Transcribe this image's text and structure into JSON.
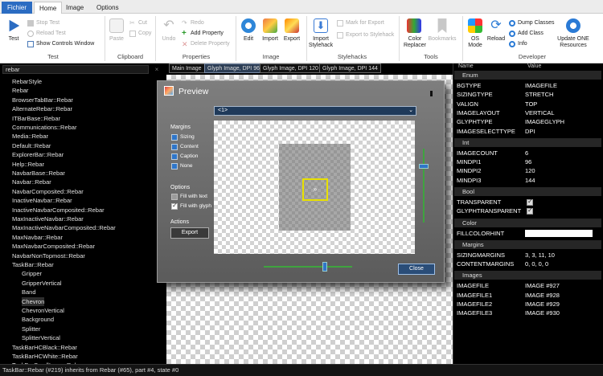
{
  "ribbon": {
    "tabs": [
      "Fichier",
      "Home",
      "Image",
      "Options"
    ],
    "test": {
      "big": "Test",
      "stop": "Stop Test",
      "reload": "Reload Test",
      "show": "Show Controls Window",
      "group": "Test"
    },
    "clipboard": {
      "paste": "Paste",
      "cut": "Cut",
      "copy": "Copy",
      "group": "Clipboard"
    },
    "properties": {
      "undo": "Undo",
      "redo": "Redo",
      "add": "Add Property",
      "delete": "Delete Property",
      "group": "Properties"
    },
    "image": {
      "edit": "Edit",
      "import": "Import",
      "export": "Export",
      "group": "Image"
    },
    "stylehacks": {
      "import": "Import Stylehack",
      "mark": "Mark for Export",
      "export": "Export to Stylehack",
      "group": "Stylehacks"
    },
    "tools": {
      "color": "Color Replacer",
      "bookmarks": "Bookmarks",
      "group": "Tools"
    },
    "developer": {
      "os": "OS Mode",
      "reload": "Reload",
      "dump": "Dump Classes",
      "addclass": "Add Class",
      "info": "Info",
      "update": "Update ONE Resources",
      "group": "Developer"
    }
  },
  "search": {
    "value": "rebar"
  },
  "tree": [
    {
      "label": "RebarStyle",
      "child": false
    },
    {
      "label": "Rebar",
      "child": false
    },
    {
      "label": "BrowserTabBar::Rebar",
      "child": false
    },
    {
      "label": "AlternateRebar::Rebar",
      "child": false
    },
    {
      "label": "ITBarBase::Rebar",
      "child": false
    },
    {
      "label": "Communications::Rebar",
      "child": false
    },
    {
      "label": "Media::Rebar",
      "child": false
    },
    {
      "label": "Default::Rebar",
      "child": false
    },
    {
      "label": "ExplorerBar::Rebar",
      "child": false
    },
    {
      "label": "Help::Rebar",
      "child": false
    },
    {
      "label": "NavbarBase::Rebar",
      "child": false
    },
    {
      "label": "Navbar::Rebar",
      "child": false
    },
    {
      "label": "NavbarComposited::Rebar",
      "child": false
    },
    {
      "label": "InactiveNavbar::Rebar",
      "child": false
    },
    {
      "label": "InactiveNavbarComposited::Rebar",
      "child": false
    },
    {
      "label": "MaxInactiveNavbar::Rebar",
      "child": false
    },
    {
      "label": "MaxInactiveNavbarComposited::Rebar",
      "child": false
    },
    {
      "label": "MaxNavbar::Rebar",
      "child": false
    },
    {
      "label": "MaxNavbarComposited::Rebar",
      "child": false
    },
    {
      "label": "NavbarNonTopmost::Rebar",
      "child": false
    },
    {
      "label": "TaskBar::Rebar",
      "child": false
    },
    {
      "label": "Gripper",
      "child": true
    },
    {
      "label": "GripperVertical",
      "child": true
    },
    {
      "label": "Band",
      "child": true
    },
    {
      "label": "Chevron",
      "child": true,
      "selected": true
    },
    {
      "label": "ChevronVertical",
      "child": true
    },
    {
      "label": "Background",
      "child": true
    },
    {
      "label": "Splitter",
      "child": true
    },
    {
      "label": "SplitterVertical",
      "child": true
    },
    {
      "label": "TaskBarHCBlack::Rebar",
      "child": false
    },
    {
      "label": "TaskBarHCWhite::Rebar",
      "child": false
    },
    {
      "label": "TaskBarSmallIcons::Rebar",
      "child": false
    }
  ],
  "doc_tabs": [
    "Main Image",
    "Glyph Image, DPI 96",
    "Glyph Image, DPI 120",
    "Glyph Image, DPI 144"
  ],
  "preview": {
    "title": "Preview",
    "select": "<1>",
    "margins_label": "Margins",
    "margins": [
      "Sizing",
      "Content",
      "Caption",
      "None"
    ],
    "options_label": "Options",
    "fill_text": "Fill with text",
    "fill_glyph": "Fill with glyph",
    "actions_label": "Actions",
    "export": "Export",
    "close": "Close",
    "chevron_glyph": "»"
  },
  "props": {
    "col_name": "Name",
    "col_value": "Value",
    "sections": {
      "enum": "Enum",
      "int": "Int",
      "bool": "Bool",
      "color": "Color",
      "margins": "Margins",
      "images": "Images"
    },
    "enum": [
      [
        "BGTYPE",
        "IMAGEFILE"
      ],
      [
        "SIZINGTYPE",
        "STRETCH"
      ],
      [
        "VALIGN",
        "TOP"
      ],
      [
        "IMAGELAYOUT",
        "VERTICAL"
      ],
      [
        "GLYPHTYPE",
        "IMAGEGLYPH"
      ],
      [
        "IMAGESELECTTYPE",
        "DPI"
      ]
    ],
    "int": [
      [
        "IMAGECOUNT",
        "6"
      ],
      [
        "MINDPI1",
        "96"
      ],
      [
        "MINDPI2",
        "120"
      ],
      [
        "MINDPI3",
        "144"
      ]
    ],
    "bool": [
      "TRANSPARENT",
      "GLYPHTRANSPARENT"
    ],
    "color_key": "FILLCOLORHINT",
    "margins": [
      [
        "SIZINGMARGINS",
        "3, 3, 11, 10"
      ],
      [
        "CONTENTMARGINS",
        "0, 0, 0, 0"
      ]
    ],
    "images": [
      [
        "IMAGEFILE",
        "IMAGE #927"
      ],
      [
        "IMAGEFILE1",
        "IMAGE #928"
      ],
      [
        "IMAGEFILE2",
        "IMAGE #929"
      ],
      [
        "IMAGEFILE3",
        "IMAGE #930"
      ]
    ]
  },
  "status": "TaskBar::Rebar (#219) inherits from Rebar (#65),  part #4,  state #0",
  "colors": {
    "accent": "#2b6cc2",
    "selection": "#2d3e55",
    "bg": "#000000"
  }
}
